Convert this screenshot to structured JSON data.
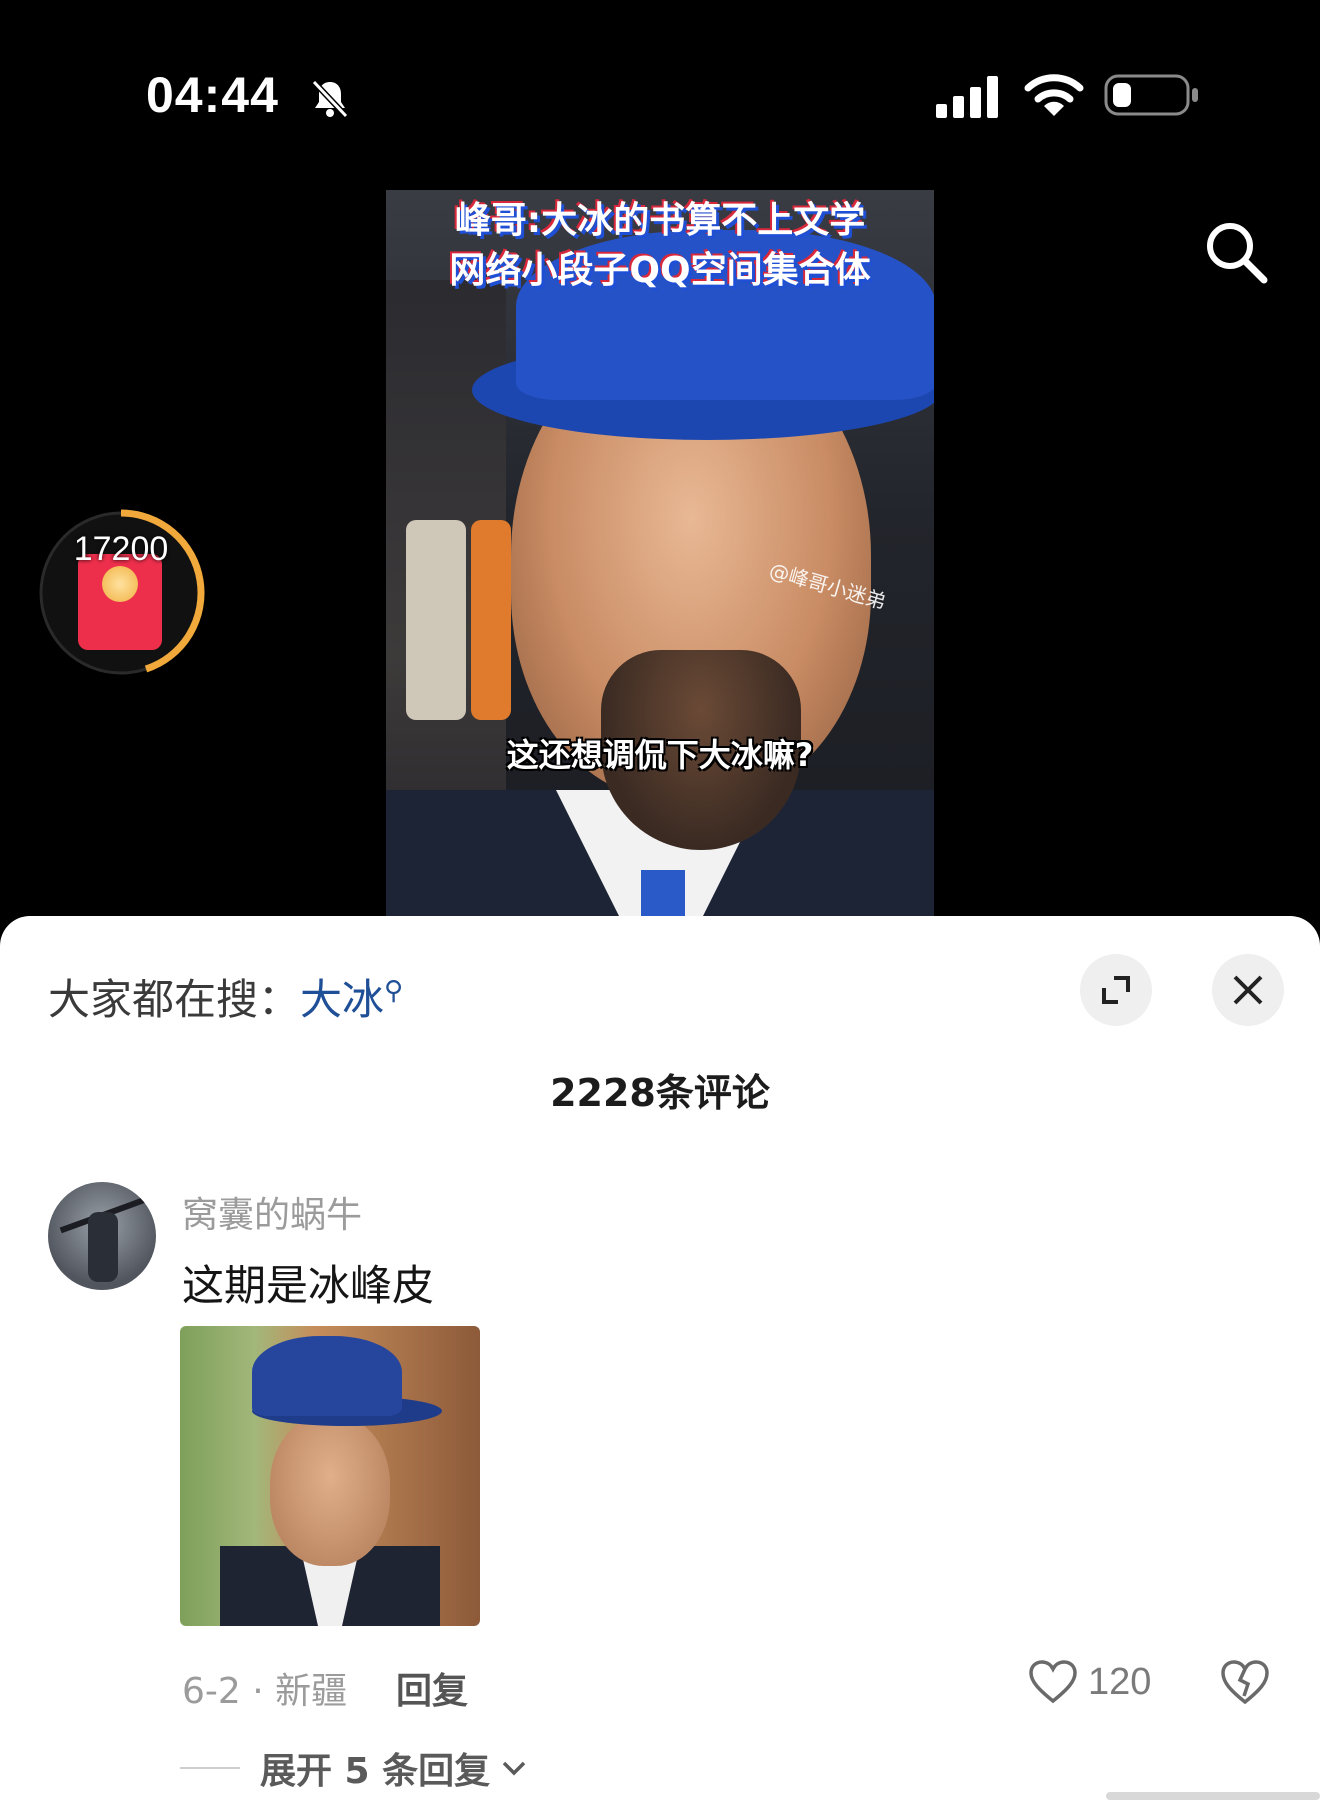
{
  "status_bar": {
    "time": "04:44"
  },
  "video": {
    "title_line1": "峰哥:大冰的书算不上文学",
    "title_line2": "网络小段子QQ空间集合体",
    "watermark": "@峰哥小迷弟",
    "caption": "这还想调侃下大冰嘛?"
  },
  "red_packet": {
    "count": "17200"
  },
  "sheet": {
    "hot_search_label": "大家都在搜：",
    "hot_search_keyword": "大冰",
    "comment_count_title": "2228条评论"
  },
  "comment": {
    "username": "窝囊的蜗牛",
    "text": "这期是冰峰皮",
    "meta": "6-2 · 新疆",
    "reply_label": "回复",
    "likes": "120",
    "expand_replies": "展开 5 条回复"
  },
  "icons": [
    "bell-muted-icon",
    "signal-icon",
    "wifi-icon",
    "battery-icon",
    "search-icon",
    "expand-icon",
    "close-icon",
    "heart-icon",
    "broken-heart-icon",
    "chevron-down-icon"
  ]
}
